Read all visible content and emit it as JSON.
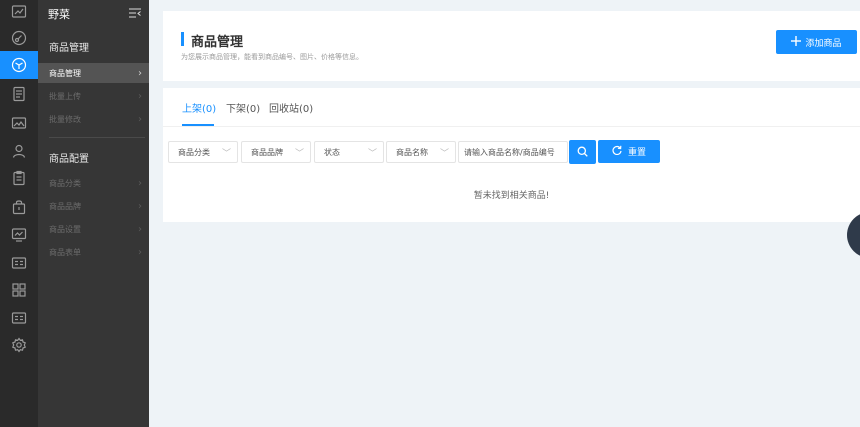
{
  "rail": {
    "icons": [
      "chart-icon",
      "link-icon",
      "cube-icon",
      "document-icon",
      "image-icon",
      "user-icon",
      "clipboard-icon",
      "bag-icon",
      "monitor-icon",
      "id-card-icon",
      "grid-icon",
      "id-card-icon",
      "settings-icon"
    ],
    "active_index": 2
  },
  "subnav": {
    "title": "野菜",
    "groups": [
      {
        "title": "商品管理",
        "items": [
          {
            "label": "商品管理",
            "active": true
          },
          {
            "label": "批量上传",
            "active": false
          },
          {
            "label": "批量修改",
            "active": false
          }
        ]
      },
      {
        "title": "商品配置",
        "items": [
          {
            "label": "商品分类",
            "active": false
          },
          {
            "label": "商品品牌",
            "active": false
          },
          {
            "label": "商品设置",
            "active": false
          },
          {
            "label": "商品表单",
            "active": false
          }
        ]
      }
    ]
  },
  "header": {
    "title": "商品管理",
    "description": "为您展示商品管理，能看到商品编号、图片、价格等信息。",
    "add_button": "添加商品"
  },
  "tabs": [
    {
      "label": "上架(0)",
      "active": true
    },
    {
      "label": "下架(0)",
      "active": false
    },
    {
      "label": "回收站(0)",
      "active": false
    }
  ],
  "filters": {
    "category": "商品分类",
    "brand": "商品品牌",
    "status": "状态",
    "name": "商品名称",
    "search_placeholder": "请输入商品名称/商品编号",
    "reset": "重置"
  },
  "empty_message": "暂未找到相关商品!",
  "colors": {
    "accent": "#1890ff",
    "rail_bg": "#2a2a2a",
    "subnav_bg": "#363636"
  }
}
